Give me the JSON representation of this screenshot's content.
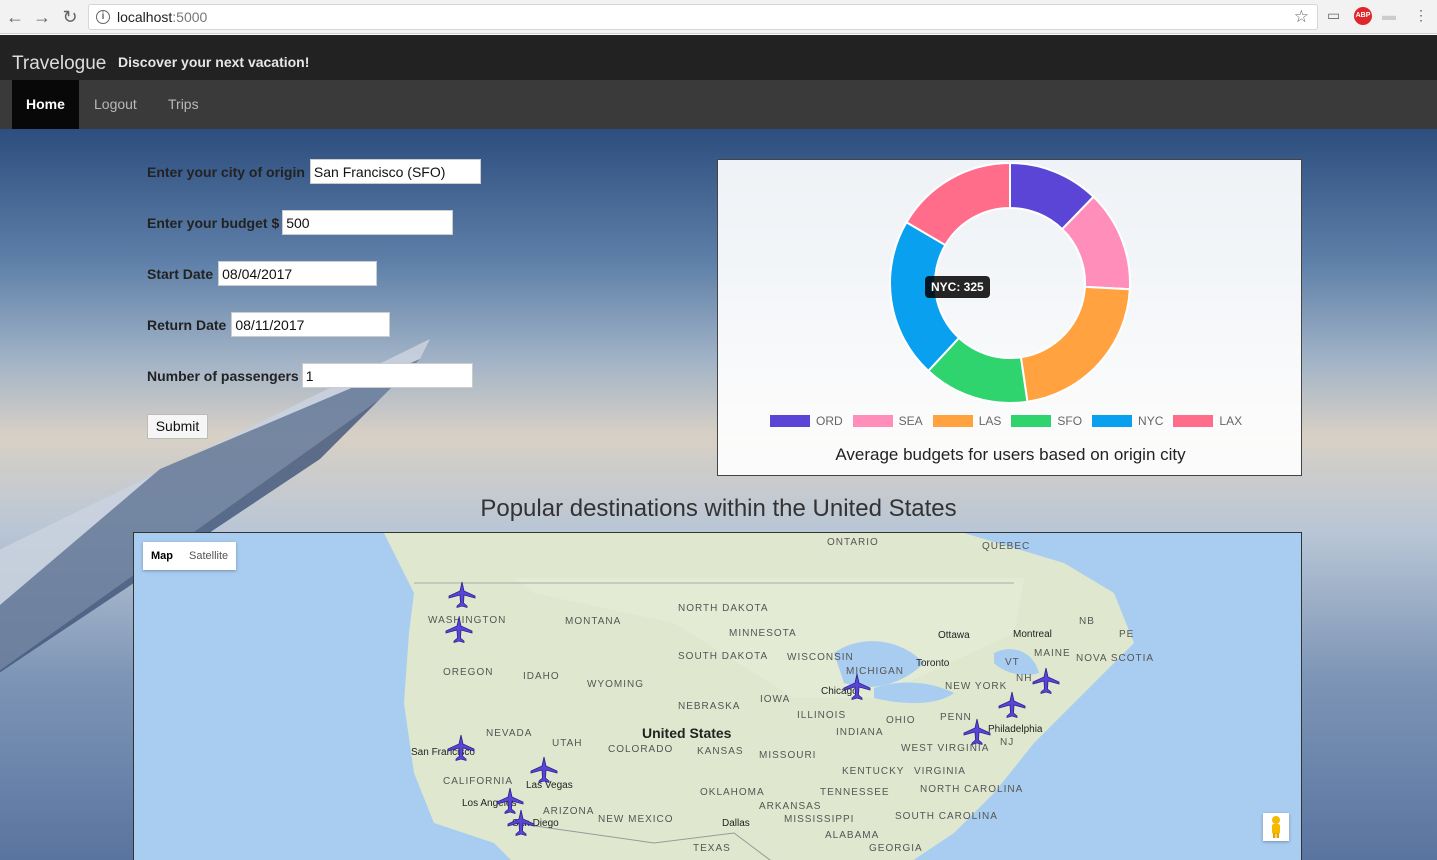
{
  "browser": {
    "url_host": "localhost",
    "url_port": ":5000",
    "abp_label": "ABP"
  },
  "app": {
    "brand": "Travelogue",
    "tagline": "Discover your next vacation!"
  },
  "nav": [
    {
      "label": "Home",
      "active": true
    },
    {
      "label": "Logout"
    },
    {
      "label": "Trips"
    }
  ],
  "form": {
    "origin_label": "Enter your city of origin",
    "origin_value": "San Francisco (SFO)",
    "budget_label": "Enter your budget $",
    "budget_value": "500",
    "start_label": "Start Date",
    "start_value": "08/04/2017",
    "return_label": "Return Date",
    "return_value": "08/11/2017",
    "passengers_label": "Number of passengers",
    "passengers_value": "1",
    "submit_label": "Submit"
  },
  "chart_data": {
    "type": "doughnut",
    "title": "Average budgets for users based on origin city",
    "labels": [
      "ORD",
      "SEA",
      "LAS",
      "SFO",
      "NYC",
      "LAX"
    ],
    "values": [
      185,
      205,
      330,
      215,
      325,
      250
    ],
    "colors": [
      "#5b45d6",
      "#ff8fba",
      "#ffa23f",
      "#2fd46f",
      "#0aa0f0",
      "#ff6d8a"
    ],
    "tooltip": "NYC: 325",
    "legend_position": "bottom"
  },
  "map": {
    "section_title": "Popular destinations within the United States",
    "type_options": [
      "Map",
      "Satellite"
    ],
    "country_label": "United States",
    "region_labels": [
      "ONTARIO",
      "QUEBEC",
      "NORTH DAKOTA",
      "MONTANA",
      "MINNESOTA",
      "WASHINGTON",
      "OREGON",
      "IDAHO",
      "WYOMING",
      "SOUTH DAKOTA",
      "WISCONSIN",
      "MICHIGAN",
      "NEBRASKA",
      "IOWA",
      "ILLINOIS",
      "INDIANA",
      "OHIO",
      "PENN",
      "NEW YORK",
      "NEVADA",
      "UTAH",
      "COLORADO",
      "KANSAS",
      "MISSOURI",
      "KENTUCKY",
      "VIRGINIA",
      "WEST VIRGINIA",
      "CALIFORNIA",
      "ARIZONA",
      "NEW MEXICO",
      "OKLAHOMA",
      "ARKANSAS",
      "TENNESSEE",
      "NORTH CAROLINA",
      "SOUTH CAROLINA",
      "MISSISSIPPI",
      "ALABAMA",
      "GEORGIA",
      "TEXAS",
      "MAINE",
      "NOVA SCOTIA",
      "NB",
      "PE",
      "VT",
      "NH",
      "NJ"
    ],
    "cities": [
      "Ottawa",
      "Montreal",
      "Toronto",
      "Chicago",
      "Philadelphia",
      "San Francisco",
      "Las Vegas",
      "Los Angeles",
      "San Diego",
      "Dallas"
    ],
    "icon_names": [
      "plane-marker-icon",
      "pegman-icon"
    ]
  }
}
